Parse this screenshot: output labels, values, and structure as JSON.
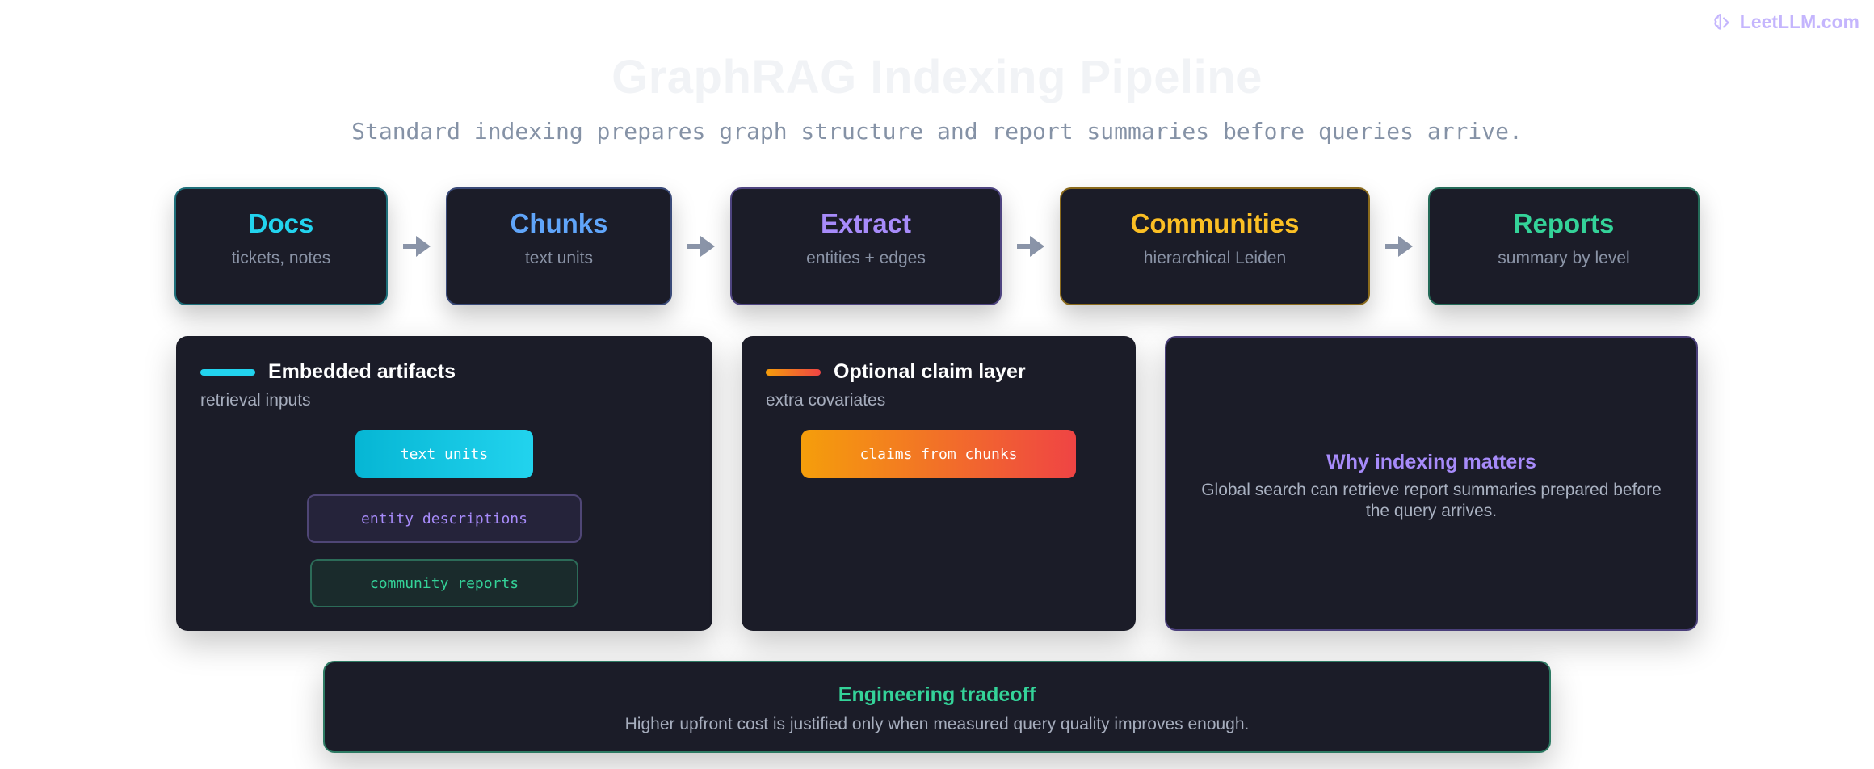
{
  "brand": {
    "text": "LeetLLM.com",
    "icon": "brain-logo-icon",
    "color": "#c4b5fd"
  },
  "header": {
    "title": "GraphRAG Indexing Pipeline",
    "subtitle": "Standard indexing prepares graph structure and report summaries before queries arrive."
  },
  "pipeline": [
    {
      "name": "Docs",
      "desc": "tickets, notes",
      "color": "#22d3ee"
    },
    {
      "name": "Chunks",
      "desc": "text units",
      "color": "#60a5fa"
    },
    {
      "name": "Extract",
      "desc": "entities + edges",
      "color": "#a78bfa"
    },
    {
      "name": "Communities",
      "desc": "hierarchical Leiden",
      "color": "#fbbf24"
    },
    {
      "name": "Reports",
      "desc": "summary by level",
      "color": "#34d399"
    }
  ],
  "arrow_icon": "arrow-right-icon",
  "artifacts": {
    "title": "Embedded artifacts",
    "subtitle": "retrieval inputs",
    "chips": [
      "text units",
      "entity descriptions",
      "community reports"
    ]
  },
  "claims": {
    "title": "Optional claim layer",
    "subtitle": "extra covariates",
    "chip": "claims from chunks"
  },
  "why": {
    "title": "Why indexing matters",
    "text": "Global search can retrieve report summaries prepared before the query arrives."
  },
  "tradeoff": {
    "title": "Engineering tradeoff",
    "text": "Higher upfront cost is justified only when measured query quality improves enough."
  }
}
